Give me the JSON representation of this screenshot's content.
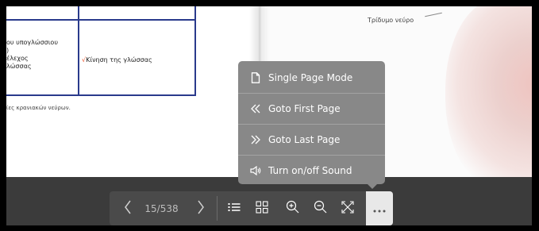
{
  "document": {
    "left_page": {
      "table": {
        "cell_left_lines": [
          "ου υπογλώσσιου",
          ")",
          "έλεχος",
          "λώσσας"
        ],
        "cell_right_mark": "√",
        "cell_right_text": "Κίνηση της γλώσσας"
      },
      "caption": "ίες κρανιακών νεύρων."
    },
    "right_page": {
      "label": "Τρίδυμο νεύρο"
    }
  },
  "menu": {
    "items": [
      {
        "label": "Single Page Mode",
        "icon": "page-icon"
      },
      {
        "label": "Goto First Page",
        "icon": "double-chevron-left-icon"
      },
      {
        "label": "Goto Last Page",
        "icon": "double-chevron-right-icon"
      },
      {
        "label": "Turn on/off Sound",
        "icon": "speaker-icon"
      }
    ]
  },
  "toolbar": {
    "page_indicator": "15/538",
    "buttons": [
      "chevron-left-icon",
      "chevron-right-icon",
      "list-icon",
      "grid-icon",
      "zoom-in-icon",
      "zoom-out-icon",
      "fullscreen-icon",
      "more-icon"
    ]
  },
  "colors": {
    "viewer_bg": "#3b3b3b",
    "toolbar_bg": "#4a4a4a",
    "menu_bg": "#888888",
    "table_border": "#2a3a8c",
    "accent_red": "#e8491d",
    "more_button_bg": "#e8e8e8"
  }
}
